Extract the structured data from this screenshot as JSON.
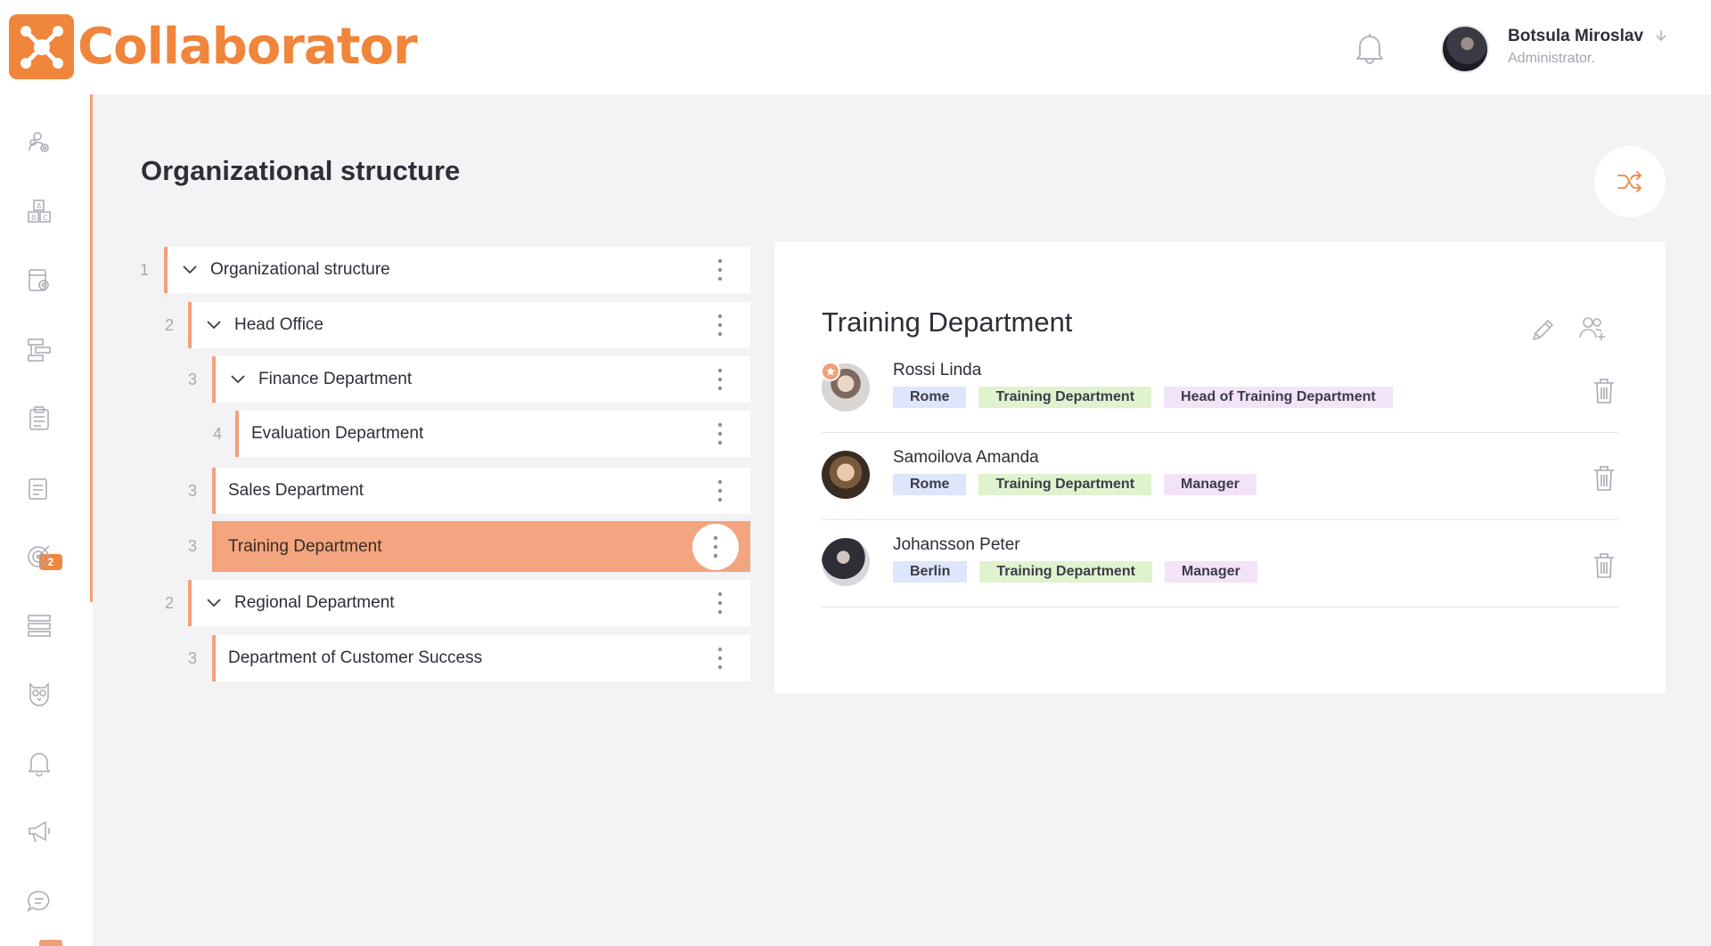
{
  "app": {
    "logo_text": "Collaborator"
  },
  "header": {
    "user_name": "Botsula Miroslav",
    "user_role": "Administrator."
  },
  "sidebar": {
    "items": [
      {
        "icon": "users-settings-icon"
      },
      {
        "icon": "abc-blocks-icon"
      },
      {
        "icon": "document-settings-icon"
      },
      {
        "icon": "structure-icon"
      },
      {
        "icon": "clipboard-icon"
      },
      {
        "icon": "tasks-icon",
        "badge": "2"
      },
      {
        "icon": "target-icon"
      },
      {
        "icon": "list-blocks-icon"
      },
      {
        "icon": "owl-icon"
      },
      {
        "icon": "bell-icon"
      },
      {
        "icon": "megaphone-icon"
      },
      {
        "icon": "chat-icon"
      }
    ],
    "accent_color": "#f2a07a"
  },
  "page": {
    "title": "Organizational structure"
  },
  "tree": [
    {
      "level": "1",
      "label": "Organizational structure",
      "expandable": true,
      "selected": false
    },
    {
      "level": "2",
      "label": "Head Office",
      "expandable": true,
      "selected": false
    },
    {
      "level": "3",
      "label": "Finance Department",
      "expandable": true,
      "selected": false
    },
    {
      "level": "4",
      "label": "Evaluation Department",
      "expandable": false,
      "selected": false
    },
    {
      "level": "3",
      "label": "Sales Department",
      "expandable": false,
      "selected": false
    },
    {
      "level": "3",
      "label": "Training Department",
      "expandable": false,
      "selected": true
    },
    {
      "level": "2",
      "label": "Regional Department",
      "expandable": true,
      "selected": false
    },
    {
      "level": "3",
      "label": "Department of Customer Success",
      "expandable": false,
      "selected": false
    }
  ],
  "detail": {
    "title": "Training Department",
    "members": [
      {
        "name": "Rossi Linda",
        "city": "Rome",
        "department": "Training Department",
        "role": "Head of Training Department",
        "is_head": true
      },
      {
        "name": "Samoilova Amanda",
        "city": "Rome",
        "department": "Training Department",
        "role": "Manager",
        "is_head": false
      },
      {
        "name": "Johansson Peter",
        "city": "Berlin",
        "department": "Training Department",
        "role": "Manager",
        "is_head": false
      }
    ]
  },
  "colors": {
    "accent": "#f0853c",
    "accent_soft": "#f2a57e",
    "tag_city": "#dde6fb",
    "tag_department": "#dff3cf",
    "tag_role": "#f3e3f8"
  }
}
